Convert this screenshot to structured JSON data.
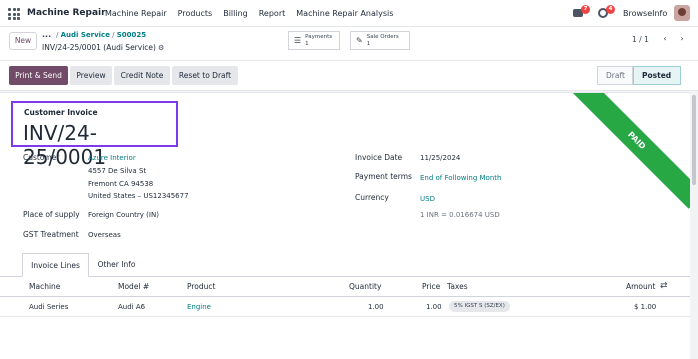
{
  "topbar": {
    "app_name": "Machine Repair",
    "menu": [
      "Machine Repair",
      "Products",
      "Billing",
      "Report",
      "Machine Repair Analysis"
    ],
    "chat_count": "7",
    "activity_count": "4",
    "company": "BrowseInfo"
  },
  "control": {
    "new_label": "New",
    "breadcrumb_dots": "...",
    "breadcrumb_1": "Audi Service",
    "breadcrumb_2": "S00025",
    "record_title": "INV/24-25/0001 (Audi Service)",
    "payments_label": "Payments",
    "payments_count": "1",
    "sale_orders_label": "Sale Orders",
    "sale_orders_count": "1",
    "pager": "1 / 1"
  },
  "actions": {
    "print_send": "Print & Send",
    "preview": "Preview",
    "credit_note": "Credit Note",
    "reset_draft": "Reset to Draft",
    "status_draft": "Draft",
    "status_posted": "Posted"
  },
  "invoice": {
    "doc_type": "Customer Invoice",
    "number": "INV/24-25/0001",
    "ribbon": "PAID",
    "customer_label": "Customer",
    "customer_name": "Azure Interior",
    "address_1": "4557 De Silva St",
    "address_2": "Fremont CA 94538",
    "address_3": "United States – US12345677",
    "place_supply_label": "Place of supply",
    "place_supply": "Foreign Country (IN)",
    "gst_label": "GST Treatment",
    "gst": "Overseas",
    "invoice_date_label": "Invoice Date",
    "invoice_date": "11/25/2024",
    "payment_terms_label": "Payment terms",
    "payment_terms": "End of Following Month",
    "currency_label": "Currency",
    "currency": "USD",
    "rate": "1 INR = 0.016674 USD"
  },
  "tabs": [
    "Invoice Lines",
    "Other Info"
  ],
  "lines": {
    "headers": [
      "Machine",
      "Model #",
      "Product",
      "Quantity",
      "Price",
      "Taxes",
      "Amount"
    ],
    "rows": [
      {
        "machine": "Audi Series",
        "model": "Audi A6",
        "product": "Engine",
        "quantity": "1.00",
        "price": "1.00",
        "taxes": "5% IGST S (SZ/EX)",
        "amount": "$ 1.00"
      }
    ]
  },
  "colors": {
    "brand": "#714b67",
    "link": "#017e84",
    "paid_ribbon": "#28a745",
    "highlight_box": "#7c3aed"
  }
}
